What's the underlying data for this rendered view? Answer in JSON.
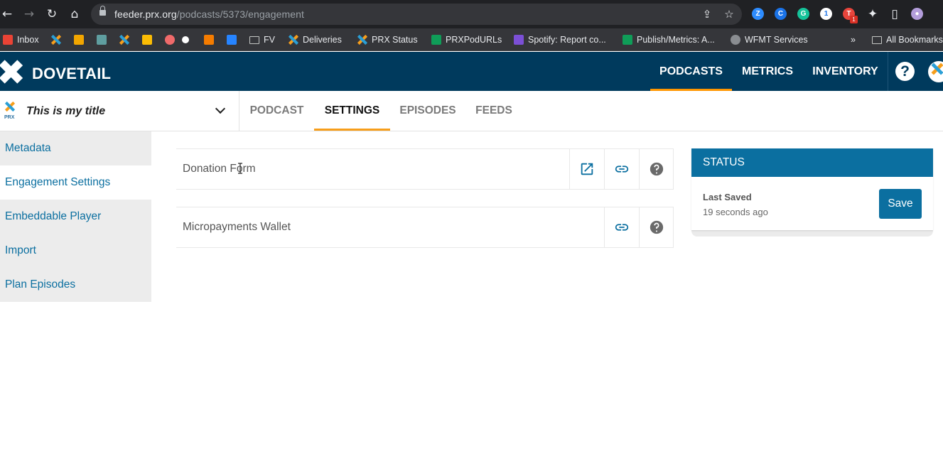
{
  "browser": {
    "url_host": "feeder.prx.org",
    "url_path": "/podcasts/5373/engagement",
    "bookmarks": [
      {
        "label": "Inbox"
      },
      {
        "label": "FV"
      },
      {
        "label": "Deliveries"
      },
      {
        "label": "PRX Status"
      },
      {
        "label": "PRXPodURLs"
      },
      {
        "label": "Spotify: Report co..."
      },
      {
        "label": "Publish/Metrics: A..."
      },
      {
        "label": "WFMT Services"
      }
    ],
    "more_bookmarks": "»",
    "all_bookmarks": "All Bookmarks",
    "extension_badge": "1"
  },
  "app": {
    "brand": "DOVETAIL",
    "nav": [
      {
        "label": "PODCASTS",
        "active": true
      },
      {
        "label": "METRICS",
        "active": false
      },
      {
        "label": "INVENTORY",
        "active": false
      }
    ],
    "help": "?"
  },
  "podcast": {
    "logo_text": "PRX",
    "title": "This is my title"
  },
  "tabs": [
    {
      "label": "PODCAST",
      "active": false
    },
    {
      "label": "SETTINGS",
      "active": true
    },
    {
      "label": "EPISODES",
      "active": false
    },
    {
      "label": "FEEDS",
      "active": false
    }
  ],
  "sidebar": [
    {
      "label": "Metadata",
      "active": false
    },
    {
      "label": "Engagement Settings",
      "active": true
    },
    {
      "label": "Embeddable Player",
      "active": false
    },
    {
      "label": "Import",
      "active": false
    },
    {
      "label": "Plan Episodes",
      "active": false
    }
  ],
  "engagement": [
    {
      "label": "Donation Form"
    },
    {
      "label": "Micropayments Wallet"
    }
  ],
  "status": {
    "heading": "STATUS",
    "last_saved_label": "Last Saved",
    "last_saved_value": "19 seconds ago",
    "save_label": "Save"
  },
  "colors": {
    "header_bg": "#003a5d",
    "accent": "#f79e1b",
    "link": "#0b6fa0"
  }
}
